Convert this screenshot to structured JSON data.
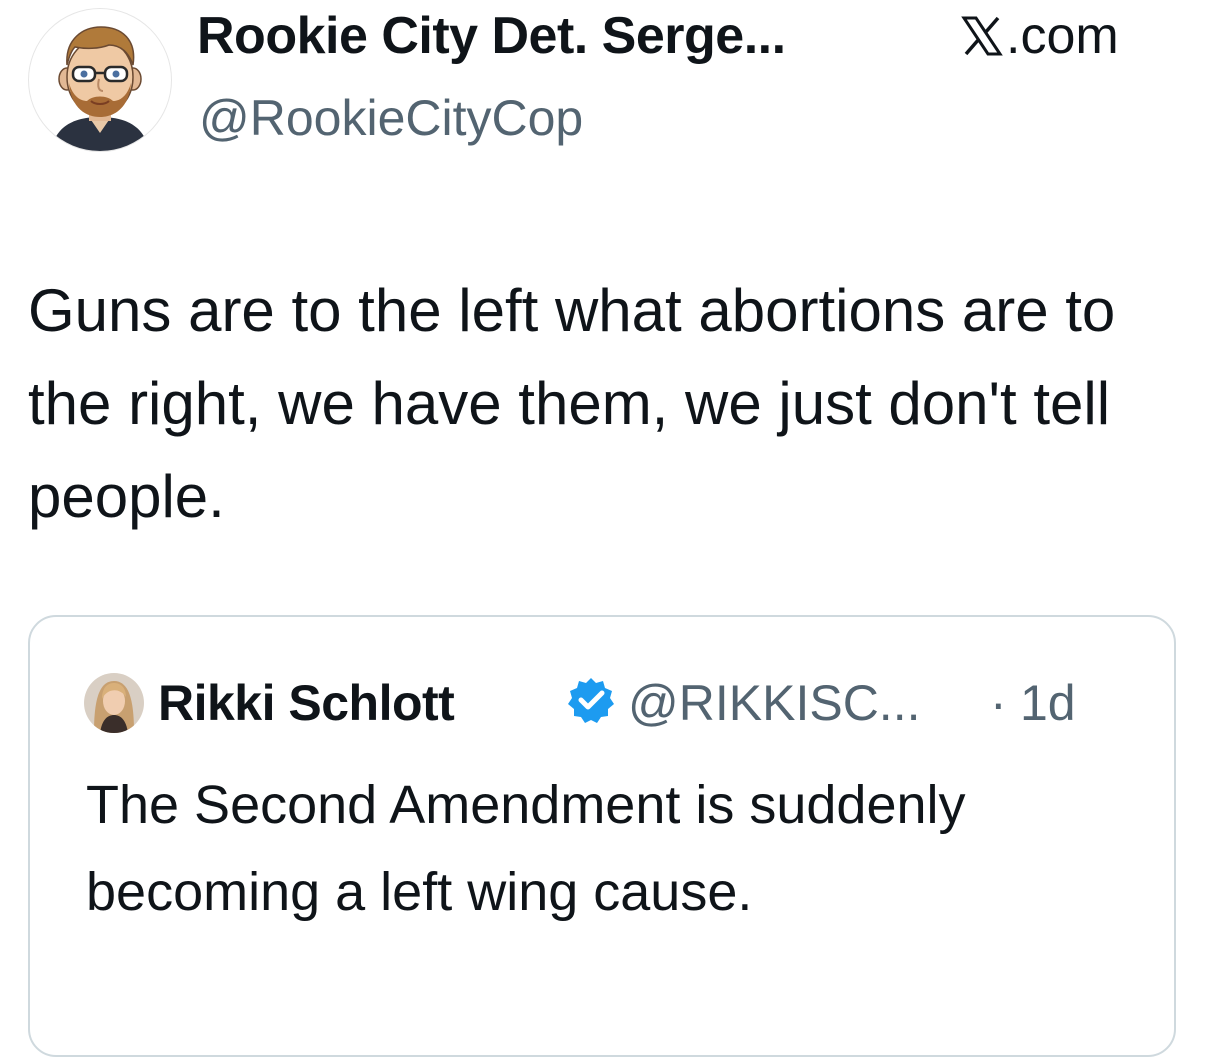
{
  "tweet": {
    "author": {
      "name": "Rookie City Det. Serge...",
      "handle": "@RookieCityCop",
      "avatar_icon": "cartoon-avatar-icon"
    },
    "source_label": ".com",
    "source_icon": "x-logo-icon",
    "text": "Guns are to the left what abortions are to the right, we have them, we just don't tell people."
  },
  "quoted_tweet": {
    "author": {
      "name": "Rikki Schlott",
      "handle": "@RIKKISC...",
      "verified": true,
      "verified_icon": "verified-badge-icon",
      "avatar_icon": "profile-photo-icon"
    },
    "separator": "·",
    "time": "1d",
    "text": "The Second Amendment is suddenly becoming a left wing cause."
  },
  "colors": {
    "text_primary": "#0f1419",
    "text_secondary": "#536471",
    "border": "#cfd9de",
    "verified_blue": "#1d9bf0"
  }
}
